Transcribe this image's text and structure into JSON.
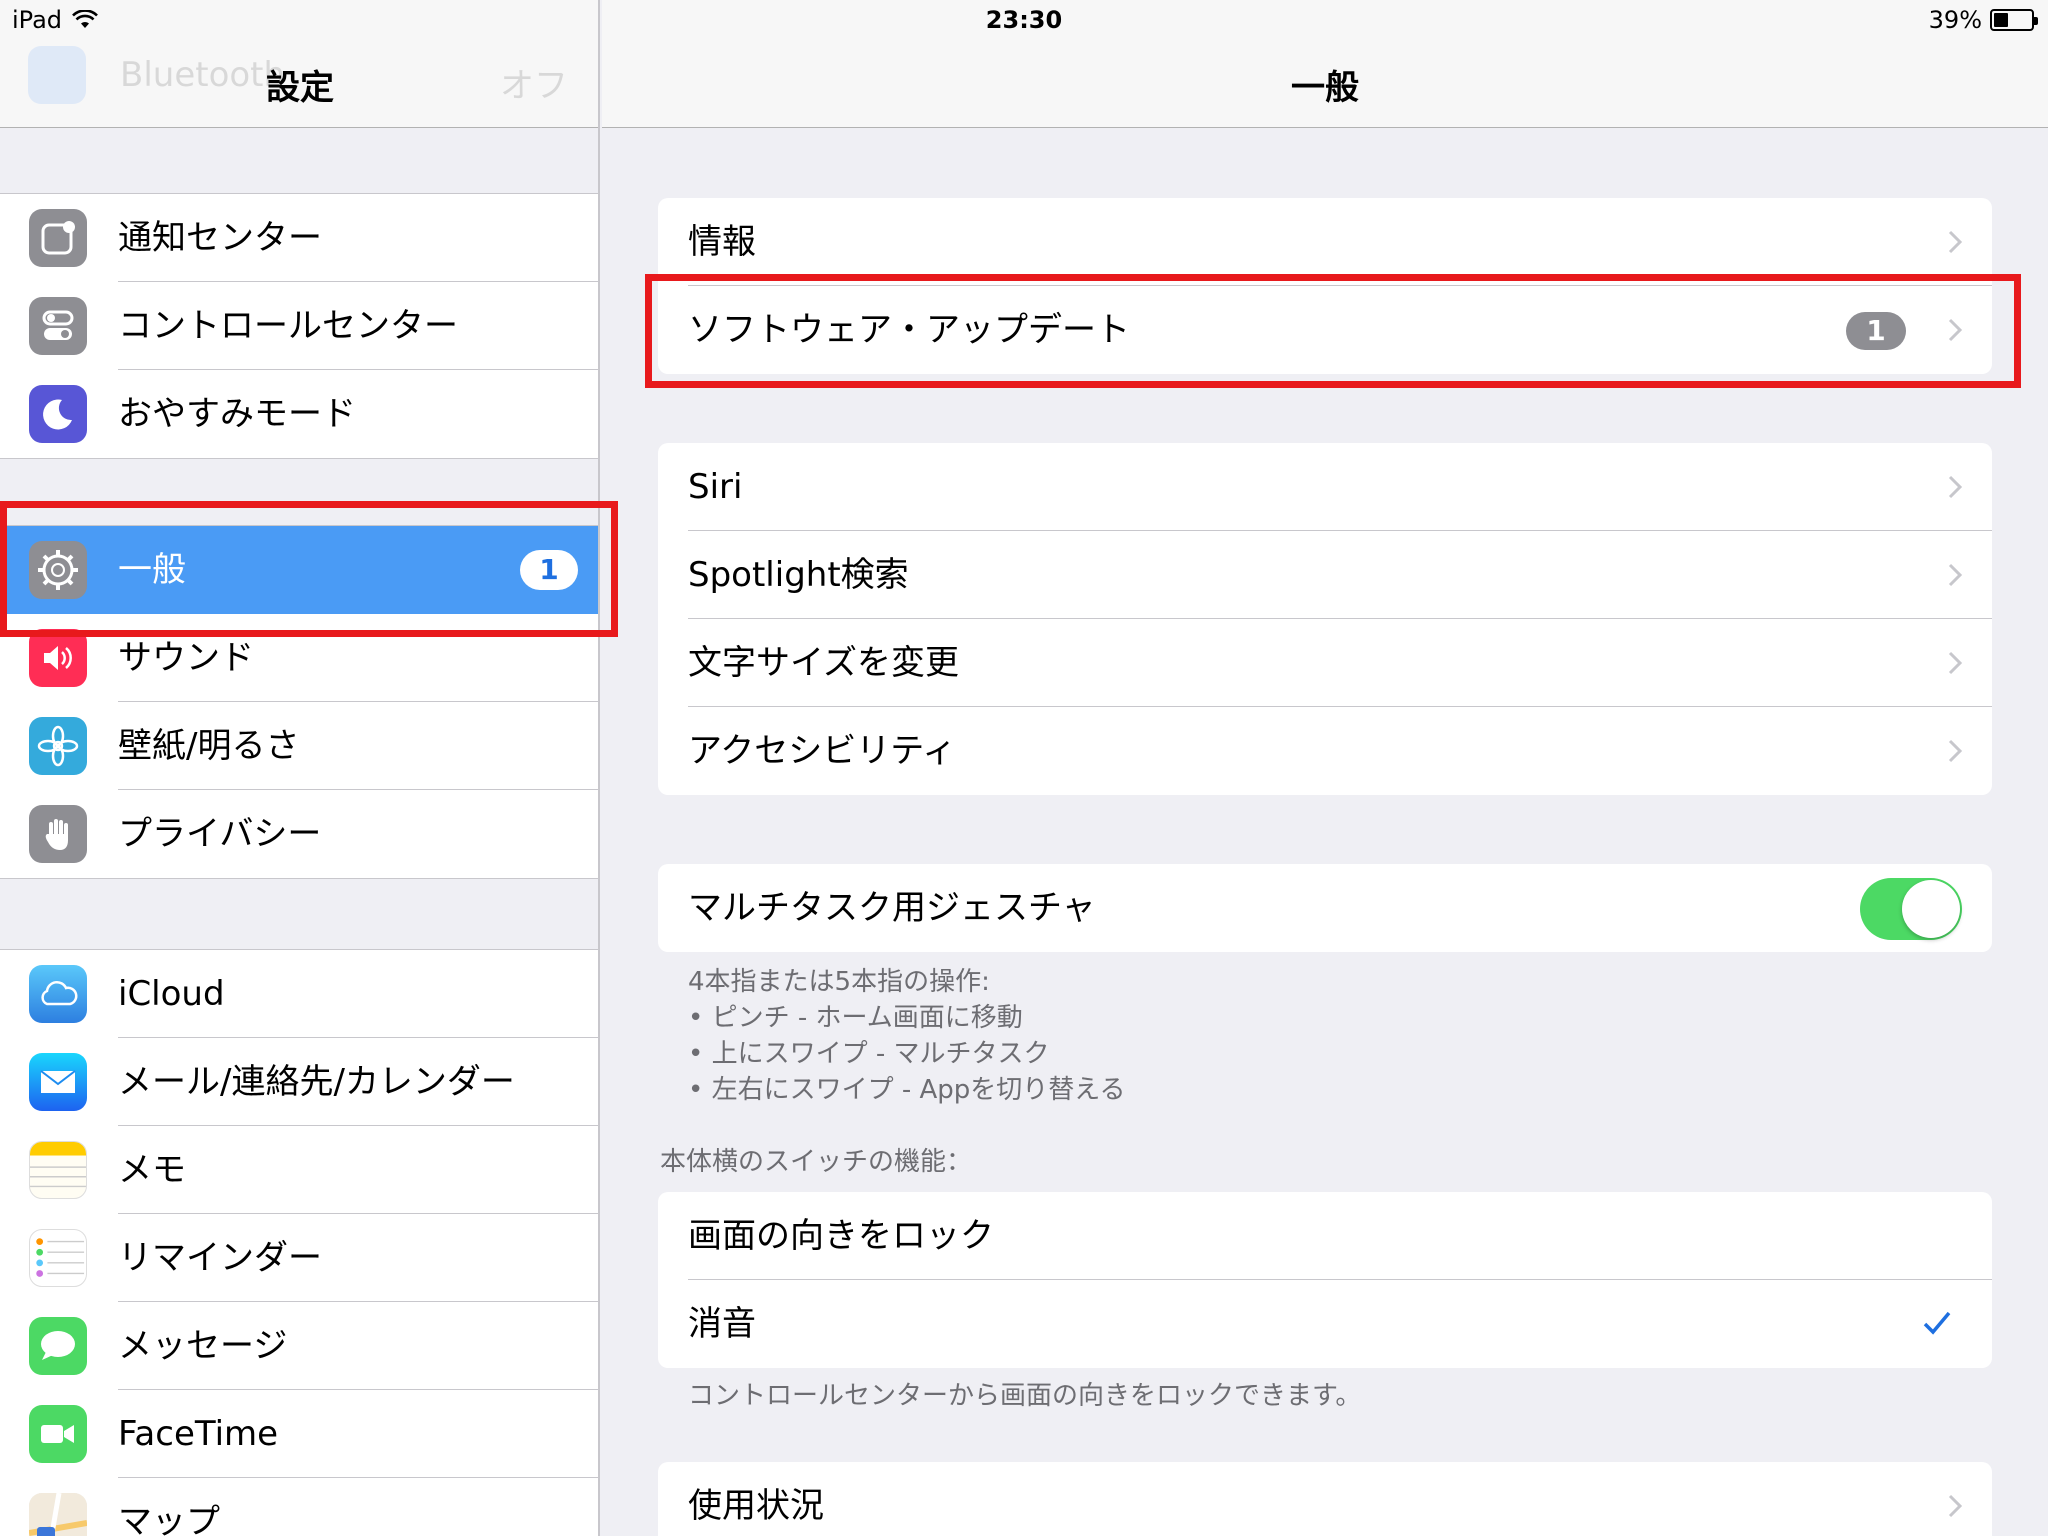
{
  "status_bar": {
    "device": "iPad",
    "time": "23:30",
    "battery_text": "39%",
    "battery_level": 0.39
  },
  "sidebar": {
    "title": "設定",
    "ghost_row": {
      "label": "Bluetooth",
      "value": "オフ"
    },
    "groups": [
      [
        {
          "label": "通知センター",
          "icon": "notification-center-icon",
          "color": "#8e8e93"
        },
        {
          "label": "コントロールセンター",
          "icon": "control-center-icon",
          "color": "#8e8e93"
        },
        {
          "label": "おやすみモード",
          "icon": "moon-icon",
          "color": "#5856d6"
        }
      ],
      [
        {
          "label": "一般",
          "icon": "gear-icon",
          "color": "#8e8e93",
          "badge": "1",
          "selected": true
        },
        {
          "label": "サウンド",
          "icon": "speaker-icon",
          "color": "#ff2d55"
        },
        {
          "label": "壁紙/明るさ",
          "icon": "flower-icon",
          "color": "#34aadc"
        },
        {
          "label": "プライバシー",
          "icon": "hand-icon",
          "color": "#8e8e93"
        }
      ],
      [
        {
          "label": "iCloud",
          "icon": "cloud-icon",
          "color": "#5ac8fa"
        },
        {
          "label": "メール/連絡先/カレンダー",
          "icon": "mail-icon",
          "color": "#1d8cf0"
        },
        {
          "label": "メモ",
          "icon": "notes-icon",
          "color": "#ffcc00"
        },
        {
          "label": "リマインダー",
          "icon": "reminders-icon",
          "color": "#ffffff"
        },
        {
          "label": "メッセージ",
          "icon": "messages-icon",
          "color": "#4cd964"
        },
        {
          "label": "FaceTime",
          "icon": "facetime-icon",
          "color": "#4cd964"
        },
        {
          "label": "マップ",
          "icon": "maps-icon",
          "color": "#e8e8e8"
        }
      ]
    ]
  },
  "main": {
    "title": "一般",
    "group1": [
      {
        "label": "情報"
      },
      {
        "label": "ソフトウェア・アップデート",
        "badge": "1"
      }
    ],
    "group2": [
      {
        "label": "Siri"
      },
      {
        "label": "Spotlight検索"
      },
      {
        "label": "文字サイズを変更"
      },
      {
        "label": "アクセシビリティ"
      }
    ],
    "multitask": {
      "label": "マルチタスク用ジェスチャ",
      "on": true
    },
    "multitask_note": [
      "4本指または5本指の操作:",
      "• ピンチ - ホーム画面に移動",
      "• 上にスワイプ - マルチタスク",
      "• 左右にスワイプ - Appを切り替える"
    ],
    "switch_header": "本体横のスイッチの機能：",
    "switch_options": [
      {
        "label": "画面の向きをロック",
        "checked": false
      },
      {
        "label": "消音",
        "checked": true
      }
    ],
    "switch_note": "コントロールセンターから画面の向きをロックできます。",
    "usage": {
      "label": "使用状況"
    }
  }
}
